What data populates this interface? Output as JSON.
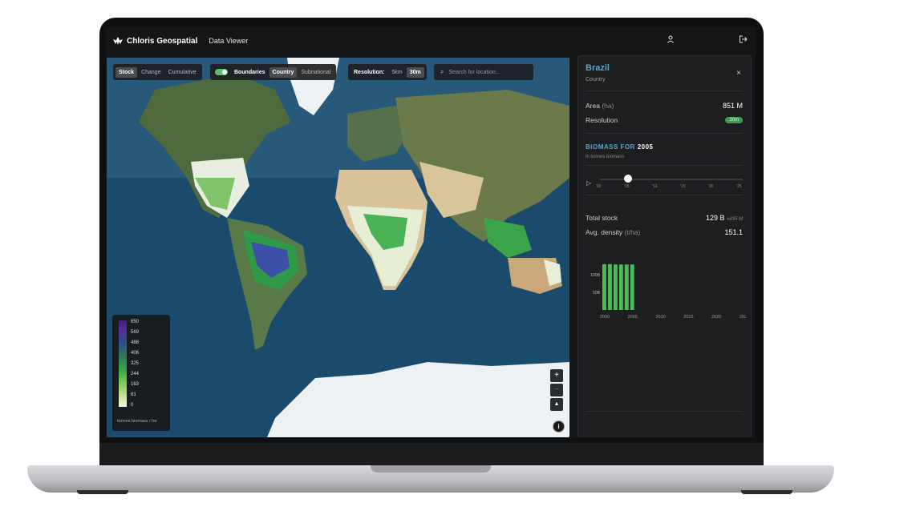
{
  "app": {
    "brand": "Chloris Geospatial",
    "title": "Data Viewer"
  },
  "header_icons": {
    "user": "user-icon",
    "logout": "logout-icon"
  },
  "toolbar": {
    "mode_tabs": [
      {
        "label": "Stock",
        "active": true
      },
      {
        "label": "Change",
        "active": false
      },
      {
        "label": "Cumulative",
        "active": false
      }
    ],
    "boundaries_label": "Boundaries",
    "boundaries_on": true,
    "boundary_tabs": [
      {
        "label": "Country",
        "active": true
      },
      {
        "label": "Subnational",
        "active": false
      }
    ],
    "resolution_label": "Resolution:",
    "resolution_tabs": [
      {
        "label": "5km",
        "active": false
      },
      {
        "label": "30m",
        "active": true
      }
    ]
  },
  "search": {
    "placeholder": "Search for location..."
  },
  "legend": {
    "ticks": [
      "650",
      "569",
      "488",
      "406",
      "325",
      "244",
      "163",
      "81",
      "0"
    ],
    "unit": "tonnes biomass / ha"
  },
  "map_controls": {
    "zoom_in": "+",
    "zoom_out": "−",
    "north": "▲",
    "info": "i"
  },
  "panel": {
    "title": "Brazil",
    "subtitle": "Country",
    "close": "×",
    "area_label": "Area",
    "area_unit": "(ha)",
    "area_value": "851 M",
    "resolution_label": "Resolution",
    "resolution_badge": "30m",
    "section_prefix": "BIOMASS FOR",
    "section_year": "2005",
    "section_sub": "in tonnes biomass",
    "timeline_ticks": [
      "'00",
      "'05",
      "'10",
      "'15",
      "'20",
      "'25"
    ],
    "timeline_value": 2005,
    "timeline_range": [
      2000,
      2025
    ],
    "total_stock_label": "Total stock",
    "total_stock_value": "129 B",
    "total_stock_note": "±835 M",
    "density_label": "Avg. density",
    "density_unit": "(t/ha)",
    "density_value": "151.1"
  },
  "chart_data": {
    "type": "bar",
    "x": [
      2000,
      2001,
      2002,
      2003,
      2004,
      2005
    ],
    "values": [
      130,
      130,
      129,
      129,
      129,
      129
    ],
    "x_ticks": [
      "2000",
      "2005",
      "2010",
      "2015",
      "2020",
      "2025"
    ],
    "y_ticks": [
      "50B",
      "100B"
    ],
    "xlim": [
      2000,
      2025
    ],
    "ylim": [
      0,
      150
    ],
    "bar_color": "#4cbb5a"
  },
  "colors": {
    "accent": "#5aa6c8",
    "green": "#4cbb5a"
  }
}
